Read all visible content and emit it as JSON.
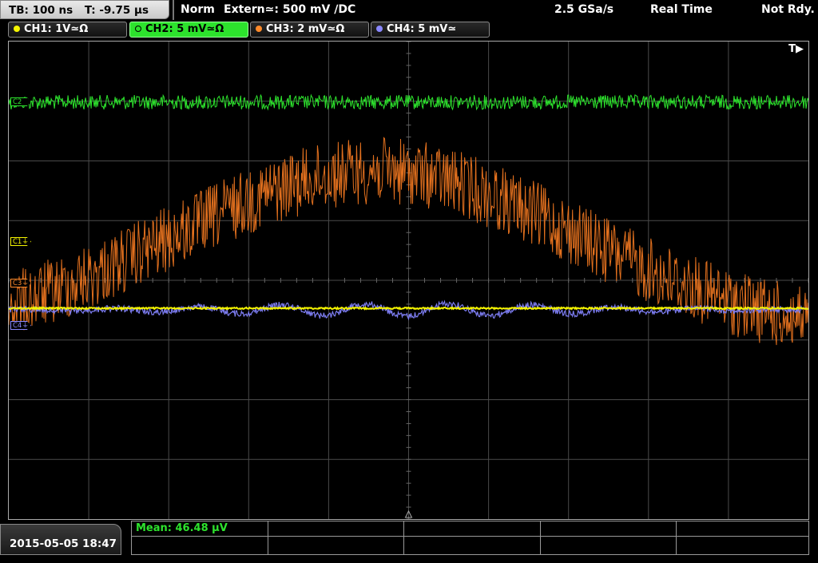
{
  "header": {
    "timebase": "TB: 100 ns",
    "trigger_time": "T: -9.75 µs",
    "mode": "Norm",
    "trigger_source": "Extern≃: 500 mV ∕DC",
    "sample_rate": "2.5 GSa/s",
    "acquisition": "Real Time",
    "state": "Not Rdy."
  },
  "channels": [
    {
      "label": "CH1: 1V≃Ω",
      "color": "#f5f500",
      "active": false
    },
    {
      "label": "CH2: 5 mV≃Ω",
      "color": "#2de32d",
      "active": true
    },
    {
      "label": "CH3: 2 mV≃Ω",
      "color": "#ff8a2a",
      "active": false
    },
    {
      "label": "CH4: 5 mV≃",
      "color": "#8a88ff",
      "active": false
    }
  ],
  "markers": {
    "c1": "C1⏚",
    "c3": "C3⏚",
    "c4": "C4⏚",
    "c2": "C2"
  },
  "trigger_indicator": "T▶",
  "footer": {
    "timestamp": "2015-05-05 18:47",
    "measurement": "Mean: 46.48 µV"
  },
  "colors": {
    "ch1": "#f5f500",
    "ch2": "#2de32d",
    "ch3": "#e2701e",
    "ch4": "#7c7cf0",
    "grid": "#4a4a4a"
  }
}
